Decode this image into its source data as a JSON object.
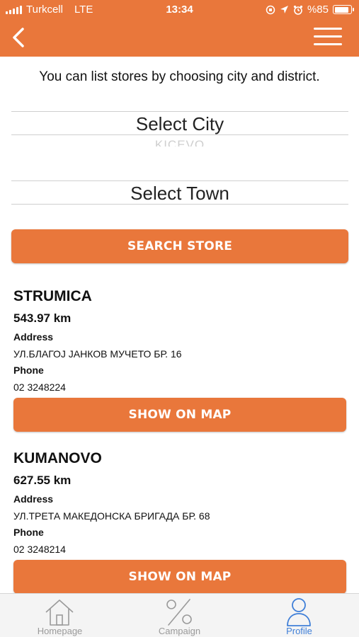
{
  "status_bar": {
    "carrier": "Turkcell",
    "network": "LTE",
    "time": "13:34",
    "battery": "%85",
    "icons": [
      "signal-icon",
      "orientation-lock-icon",
      "location-arrow-icon",
      "alarm-icon",
      "battery-icon"
    ]
  },
  "nav": {
    "back_icon": "chevron-left-icon",
    "menu_icon": "hamburger-menu-icon"
  },
  "intro_text": "You can list stores by choosing city and district.",
  "city_picker": {
    "value": "Select City",
    "next_option": "KICEVO"
  },
  "town_picker": {
    "value": "Select Town"
  },
  "search_button": "SEARCH STORE",
  "stores": [
    {
      "name": "STRUMICA",
      "distance": "543.97 km",
      "address_label": "Address",
      "address": "УЛ.БЛАГОЈ ЈАНКОВ МУЧЕТО БР. 16",
      "phone_label": "Phone",
      "phone": "02 3248224",
      "map_button": "SHOW ON MAP"
    },
    {
      "name": "KUMANOVO",
      "distance": "627.55 km",
      "address_label": "Address",
      "address": "УЛ.ТРЕТА МАКЕДОНСКА БРИГАДА БР. 68",
      "phone_label": "Phone",
      "phone": "02 3248214",
      "map_button": "SHOW ON MAP"
    }
  ],
  "tabs": [
    {
      "label": "Homepage",
      "icon": "home-icon",
      "active": false
    },
    {
      "label": "Campaign",
      "icon": "percent-icon",
      "active": false
    },
    {
      "label": "Profile",
      "icon": "profile-icon",
      "active": true
    }
  ],
  "colors": {
    "accent": "#e9773b",
    "active_tab": "#3f7fd8",
    "inactive_tab": "#9a9a9a"
  }
}
